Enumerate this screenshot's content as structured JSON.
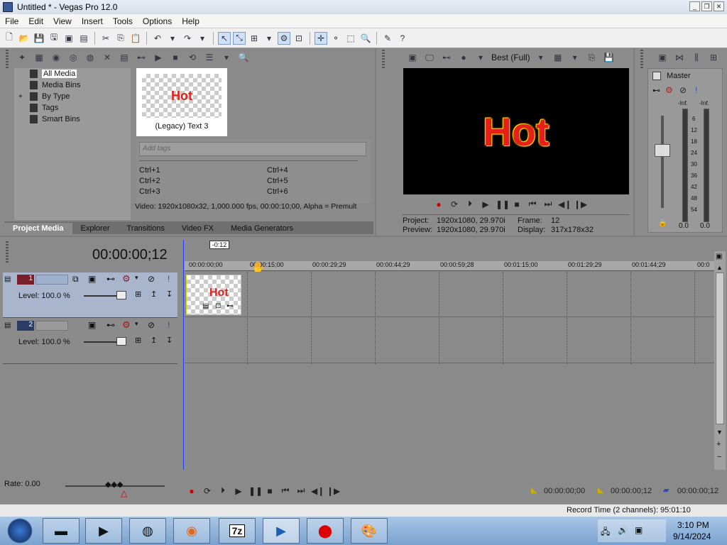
{
  "window": {
    "title": "Untitled * - Vegas Pro 12.0"
  },
  "menu": [
    "File",
    "Edit",
    "View",
    "Insert",
    "Tools",
    "Options",
    "Help"
  ],
  "explorer": {
    "tree": [
      "All Media",
      "Media Bins",
      "By Type",
      "Tags",
      "Smart Bins"
    ],
    "media_item": {
      "thumb_text": "Hot",
      "label": "(Legacy) Text 3"
    },
    "tags_placeholder": "Add tags",
    "shortcuts": [
      "Ctrl+1",
      "Ctrl+4",
      "Ctrl+2",
      "Ctrl+5",
      "Ctrl+3",
      "Ctrl+6"
    ],
    "info": "Video: 1920x1080x32, 1,000.000 fps, 00:00:10;00, Alpha = Premult"
  },
  "tabs": [
    "Project Media",
    "Explorer",
    "Transitions",
    "Video FX",
    "Media Generators"
  ],
  "preview": {
    "quality": "Best (Full)",
    "text": "Hot",
    "project_label": "Project:",
    "project_value": "1920x1080, 29.970i",
    "preview_label": "Preview:",
    "preview_value": "1920x1080, 29.970i",
    "frame_label": "Frame:",
    "frame_value": "12",
    "display_label": "Display:",
    "display_value": "317x178x32"
  },
  "mixer": {
    "title": "Master",
    "scale": [
      "-Inf.",
      "-Inf.",
      "6",
      "12",
      "18",
      "24",
      "30",
      "36",
      "42",
      "48",
      "54"
    ],
    "left": "0.0",
    "right": "0.0"
  },
  "timeline": {
    "timecode": "00:00:00;12",
    "cursor_marker": "-0:12",
    "ruler": [
      "00:00:00;00",
      "00:00:15;00",
      "00:00:29;29",
      "00:00:44;29",
      "00:00:59;28",
      "00:01:15;00",
      "00:01:29;29",
      "00:01:44;29",
      "00:0"
    ],
    "tracks": [
      {
        "num": "1",
        "level": "Level: 100.0 %"
      },
      {
        "num": "2",
        "level": "Level: 100.0 %"
      }
    ],
    "clip_text": "Hot"
  },
  "bottom": {
    "rate": "Rate: 0.00",
    "tc1": "00:00:00;00",
    "tc2": "00:00:00;12",
    "tc3": "00:00:00;12"
  },
  "status": {
    "record_time": "Record Time (2 channels): 95:01:10"
  },
  "taskbar": {
    "time": "3:10 PM",
    "date": "9/14/2024",
    "app_7z": "7z"
  }
}
